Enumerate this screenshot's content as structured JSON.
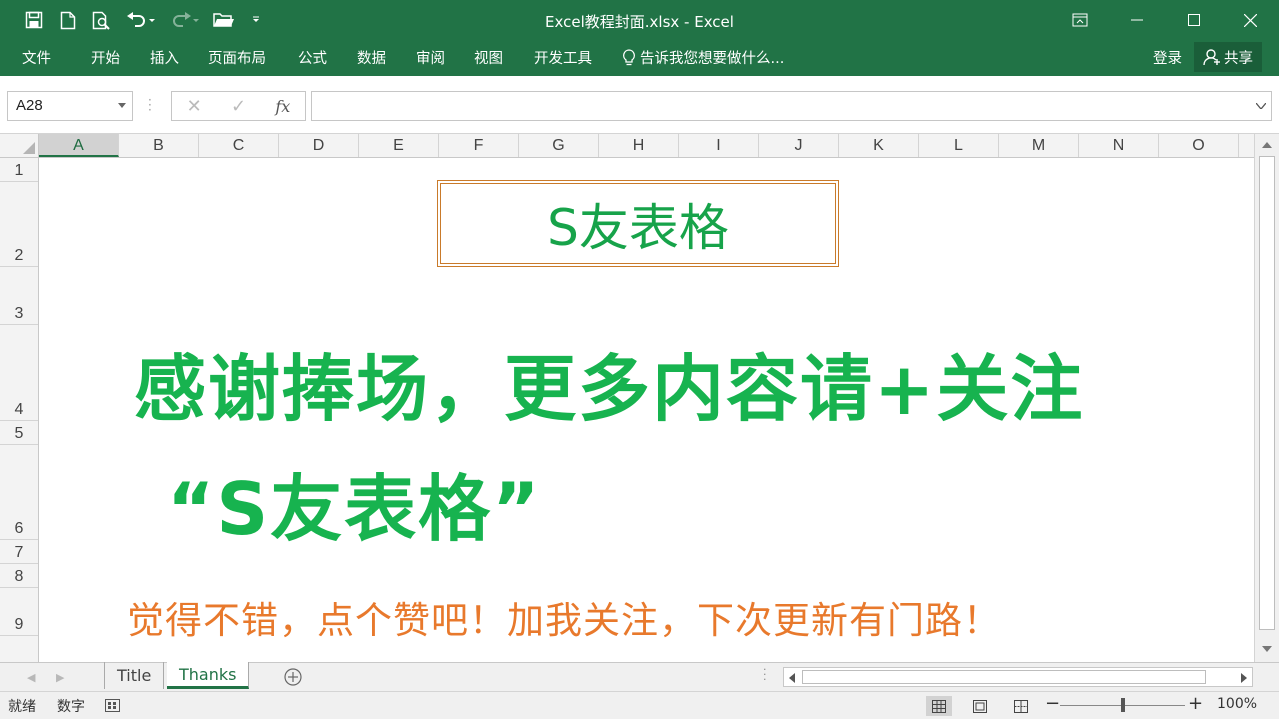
{
  "window": {
    "title": "Excel教程封面.xlsx - Excel"
  },
  "qat": {
    "icons": [
      "save-icon",
      "new-file-icon",
      "print-preview-icon",
      "undo-icon",
      "redo-icon",
      "open-folder-icon",
      "customize-icon"
    ]
  },
  "ribbon": {
    "tabs": [
      "文件",
      "开始",
      "插入",
      "页面布局",
      "公式",
      "数据",
      "审阅",
      "视图",
      "开发工具"
    ],
    "tell_me": "告诉我您想要做什么...",
    "login": "登录",
    "share": "共享"
  },
  "formula_bar": {
    "name_box": "A28",
    "cancel": "✕",
    "enter": "✓",
    "fx": "fx",
    "value": ""
  },
  "columns": [
    "A",
    "B",
    "C",
    "D",
    "E",
    "F",
    "G",
    "H",
    "I",
    "J",
    "K",
    "L",
    "M",
    "N",
    "O"
  ],
  "selected_column": "A",
  "rows": [
    "1",
    "2",
    "3",
    "4",
    "5",
    "6",
    "7",
    "8",
    "9"
  ],
  "sheet": {
    "title_box": "S友表格",
    "line1": "感谢捧场，更多内容请+关注",
    "line2": "“S友表格”",
    "line3": "觉得不错，点个赞吧！加我关注，下次更新有门路！"
  },
  "sheet_tabs": {
    "tabs": [
      "Title",
      "Thanks"
    ],
    "active": "Thanks"
  },
  "statusbar": {
    "ready": "就绪",
    "num": "数字",
    "zoom": "100%"
  },
  "colors": {
    "accent": "#217346",
    "title_green": "#17a34a",
    "big_green": "#17b34f",
    "orange": "#e8792c",
    "box_border": "#c97a2a"
  }
}
